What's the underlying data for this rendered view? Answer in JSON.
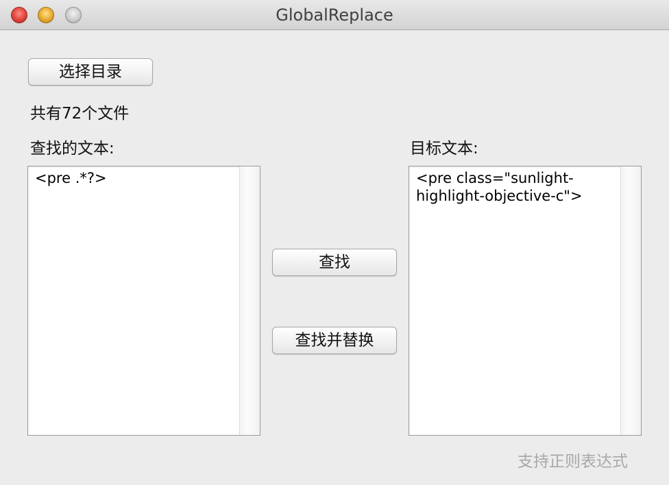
{
  "window": {
    "title": "GlobalReplace"
  },
  "buttons": {
    "choose_dir": "选择目录",
    "find": "查找",
    "find_replace": "查找并替换"
  },
  "file_count_text": "共有72个文件",
  "search": {
    "label": "查找的文本:",
    "value": "<pre .*?>"
  },
  "target": {
    "label": "目标文本:",
    "value": "<pre class=\"sunlight-\nhighlight-objective-c\">"
  },
  "regex_hint": "支持正则表达式"
}
